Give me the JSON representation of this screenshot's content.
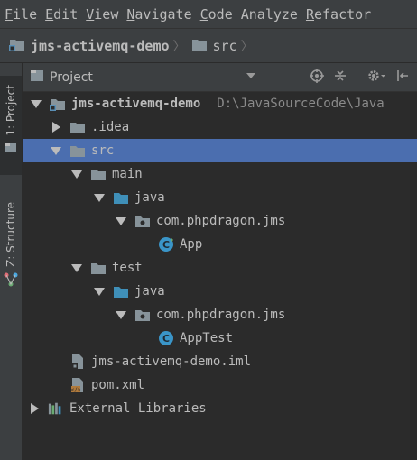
{
  "menu": [
    {
      "u": "F",
      "rest": "ile"
    },
    {
      "u": "E",
      "rest": "dit"
    },
    {
      "u": "V",
      "rest": "iew"
    },
    {
      "u": "N",
      "rest": "avigate"
    },
    {
      "u": "C",
      "rest": "ode"
    },
    {
      "u": "",
      "rest": "Analyze"
    },
    {
      "u": "R",
      "rest": "efactor"
    }
  ],
  "breadcrumb": {
    "project": "jms-activemq-demo",
    "folder": "src"
  },
  "side_tabs": {
    "project": "1: Project",
    "structure": "Z: Structure"
  },
  "panel": {
    "title": "Project"
  },
  "tree": {
    "root": {
      "label": "jms-activemq-demo",
      "path": "D:\\JavaSourceCode\\Java"
    },
    "idea": "idea_placeholder",
    "items": {
      "idea": ".idea",
      "src": "src",
      "main": "main",
      "java1": "java",
      "pkg1": "com.phpdragon.jms",
      "app": "App",
      "test": "test",
      "java2": "java",
      "pkg2": "com.phpdragon.jms",
      "apptest": "AppTest",
      "iml": "jms-activemq-demo.iml",
      "pom": "pom.xml",
      "libs": "External Libraries"
    }
  },
  "colors": {
    "selection": "#4b6eaf",
    "folder": "#87939a",
    "source_folder": "#3f8fb8",
    "class": "#3a95c8"
  }
}
